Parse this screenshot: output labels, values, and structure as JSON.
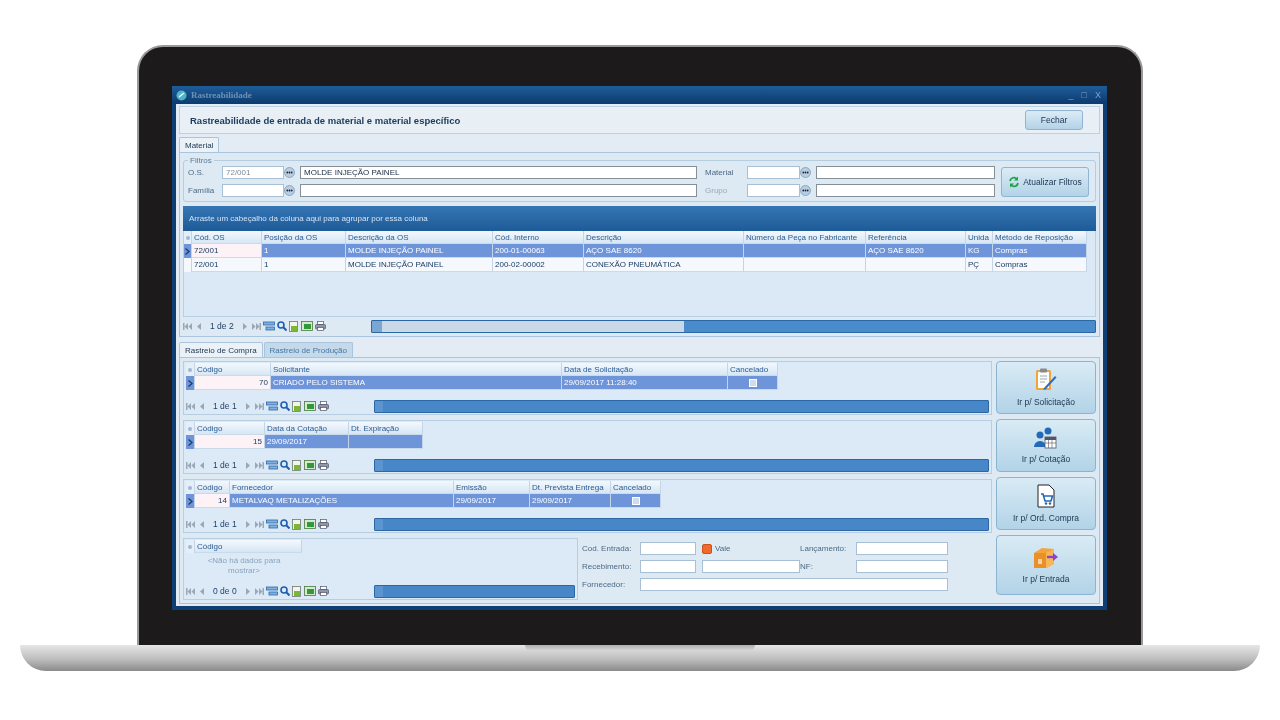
{
  "window": {
    "title": "Rastreabilidade",
    "controls": [
      "_",
      "□",
      "X"
    ]
  },
  "header": {
    "title": "Rastreabilidade de entrada de material e material específico",
    "close_button": "Fechar"
  },
  "tabs": [
    {
      "label": "Material",
      "selected": true
    }
  ],
  "filters": {
    "legend": "Filtros",
    "fields": [
      {
        "label": "O.S.",
        "code": "72/001",
        "description": "MOLDE INJEÇÃO PAINEL",
        "disabled": false
      },
      {
        "label": "Material",
        "disabled": false
      },
      {
        "label": "Família",
        "disabled": false
      },
      {
        "label": "Grupo",
        "disabled": true
      }
    ],
    "refresh_button": "Atualizar Filtros"
  },
  "main_grid": {
    "group_hint": "Arraste um cabeçalho da coluna aqui para agrupar por essa coluna",
    "columns": [
      {
        "label": "Cód. OS",
        "kind": "text"
      },
      {
        "label": "Posição da OS",
        "kind": "text"
      },
      {
        "label": "Descrição da OS",
        "kind": "text"
      },
      {
        "label": "Cód. Interno",
        "kind": "text"
      },
      {
        "label": "Descrição",
        "kind": "text"
      },
      {
        "label": "Número da Peça no Fabricante",
        "kind": "text"
      },
      {
        "label": "Referência",
        "kind": "text"
      },
      {
        "label": "Unida",
        "kind": "text"
      },
      {
        "label": "Método de Reposição",
        "kind": "text"
      }
    ],
    "rows": [
      {
        "selected": true,
        "cells": [
          "72/001",
          "1",
          "MOLDE INJEÇÃO PAINEL",
          "200-01-00063",
          "AÇO SAE 8620",
          null,
          "AÇO SAE 8620",
          "KG",
          "Compras"
        ]
      },
      {
        "selected": false,
        "cells": [
          "72/001",
          "1",
          "MOLDE INJEÇÃO PAINEL",
          "200-02-00002",
          "CONEXÃO PNEUMÁTICA",
          null,
          null,
          "PÇ",
          "Compras"
        ]
      }
    ],
    "pager": "1 de 2"
  },
  "tracking_tabs": [
    {
      "label": "Rastreio de Compra",
      "selected": true
    },
    {
      "label": "Rastreio de Produção",
      "selected": false
    }
  ],
  "purchase_grids": [
    {
      "columns": [
        {
          "label": "Código",
          "kind": "number"
        },
        {
          "label": "Solicitante",
          "kind": "text"
        },
        {
          "label": "Data de Solicitação",
          "kind": "text"
        },
        {
          "label": "Cancelado",
          "kind": "checkbox"
        }
      ],
      "rows": [
        {
          "selected": true,
          "cells": [
            "70",
            "CRIADO PELO SISTEMA",
            "29/09/2017 11:28:40",
            false
          ]
        }
      ],
      "pager": "1 de 1"
    },
    {
      "columns": [
        {
          "label": "Código",
          "kind": "number"
        },
        {
          "label": "Data da Cotação",
          "kind": "text"
        },
        {
          "label": "Dt. Expiração",
          "kind": "text"
        }
      ],
      "rows": [
        {
          "selected": true,
          "cells": [
            "15",
            "29/09/2017",
            null
          ]
        }
      ],
      "pager": "1 de 1"
    },
    {
      "columns": [
        {
          "label": "Código",
          "kind": "number"
        },
        {
          "label": "Fornecedor",
          "kind": "text"
        },
        {
          "label": "Emissão",
          "kind": "text"
        },
        {
          "label": "Dt. Prevista Entrega",
          "kind": "text"
        },
        {
          "label": "Cancelado",
          "kind": "checkbox"
        }
      ],
      "rows": [
        {
          "selected": true,
          "cells": [
            "14",
            "METALVAQ METALIZAÇÕES",
            "29/09/2017",
            "29/09/2017",
            false
          ]
        }
      ],
      "pager": "1 de 1"
    }
  ],
  "entry_grid": {
    "columns": [
      {
        "label": "Código"
      }
    ],
    "empty_text": "<Não há dados para mostrar>",
    "pager": "0 de 0"
  },
  "entry_form": {
    "fields": [
      {
        "label": "Cod. Entrada:",
        "kind": "input"
      },
      {
        "label": "Vale",
        "kind": "checkbox",
        "checked": false
      },
      {
        "label": "Lançamento:",
        "kind": "input"
      },
      {
        "label": "Recebimento:",
        "kind": "double"
      },
      {
        "label": "NF:",
        "kind": "input"
      },
      {
        "label": "Fornecedor:",
        "kind": "wide"
      }
    ]
  },
  "action_buttons": [
    "Ir p/ Solicitação",
    "Ir p/ Cotação",
    "Ir p/ Ord. Compra",
    "Ir p/ Entrada"
  ]
}
